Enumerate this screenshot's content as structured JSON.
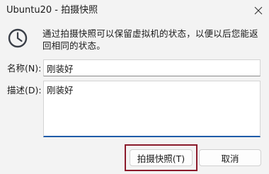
{
  "window": {
    "title": "Ubuntu20 - 拍摄快照"
  },
  "icons": {
    "close": "close-icon",
    "clock": "clock-icon"
  },
  "message": "通过拍摄快照可以保留虚拟机的状态，以便以后您能返回相同的状态。",
  "form": {
    "name_label": "名称(N):",
    "name_value": "刚装好",
    "desc_label": "描述(D):",
    "desc_value": "刚装好"
  },
  "buttons": {
    "snapshot_label": "拍摄快照(T)",
    "cancel_label": "取消"
  },
  "colors": {
    "focus_highlight": "#8b1a2b",
    "active_field_underline": "#1e5ba8"
  }
}
